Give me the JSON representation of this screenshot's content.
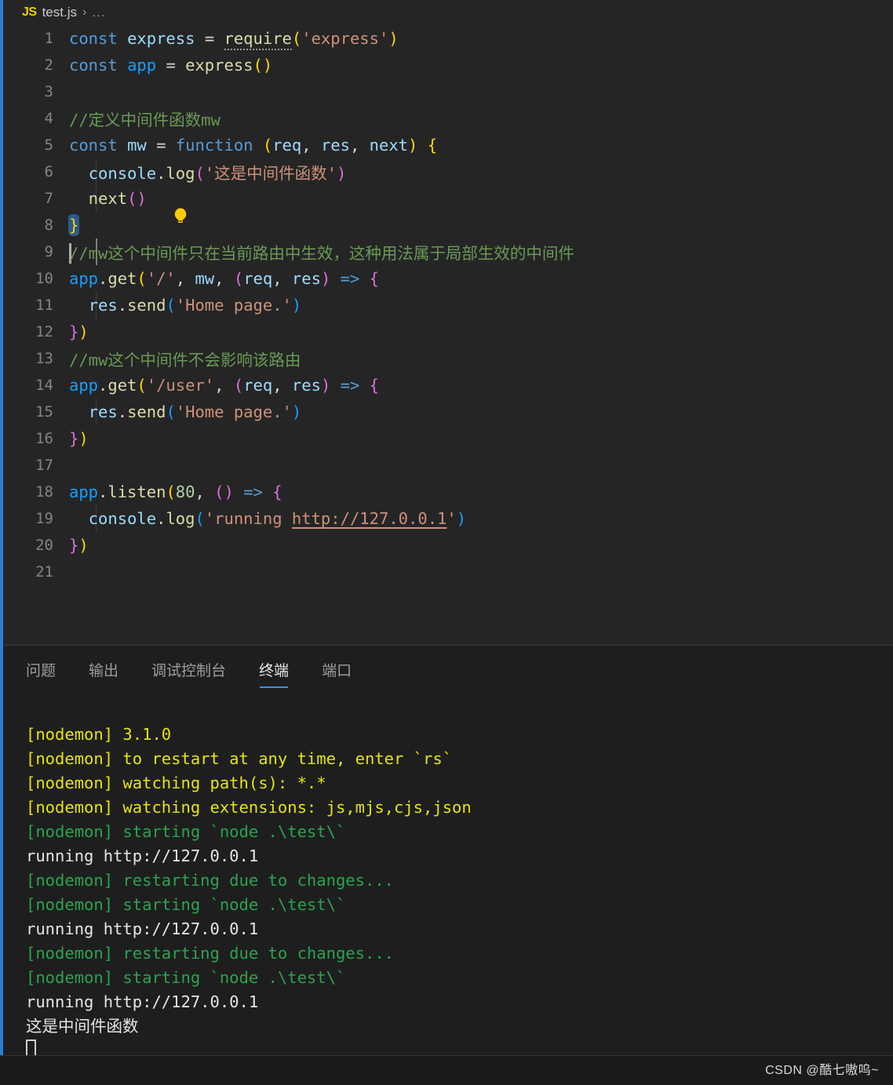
{
  "breadcrumb": {
    "lang_badge": "JS",
    "file": "test.js",
    "separator": "›",
    "ellipsis": "..."
  },
  "editor": {
    "lines": [
      {
        "no": "1",
        "text": "const express = require('express')"
      },
      {
        "no": "2",
        "text": "const app = express()"
      },
      {
        "no": "3",
        "text": ""
      },
      {
        "no": "4",
        "text": "//定义中间件函数mw"
      },
      {
        "no": "5",
        "text": "const mw = function (req, res, next) {"
      },
      {
        "no": "6",
        "text": "  console.log('这是中间件函数')"
      },
      {
        "no": "7",
        "text": "  next()"
      },
      {
        "no": "8",
        "text": "}"
      },
      {
        "no": "9",
        "text": "//mw这个中间件只在当前路由中生效，这种用法属于局部生效的中间件"
      },
      {
        "no": "10",
        "text": "app.get('/', mw, (req, res) => {"
      },
      {
        "no": "11",
        "text": "  res.send('Home page.')"
      },
      {
        "no": "12",
        "text": "})"
      },
      {
        "no": "13",
        "text": "//mw这个中间件不会影响该路由"
      },
      {
        "no": "14",
        "text": "app.get('/user', (req, res) => {"
      },
      {
        "no": "15",
        "text": "  res.send('Home page.')"
      },
      {
        "no": "16",
        "text": "})"
      },
      {
        "no": "17",
        "text": ""
      },
      {
        "no": "18",
        "text": "app.listen(80, () => {"
      },
      {
        "no": "19",
        "text": "  console.log('running http://127.0.0.1')"
      },
      {
        "no": "20",
        "text": "})"
      },
      {
        "no": "21",
        "text": ""
      }
    ],
    "tokens": {
      "kw_const": "const",
      "kw_function": "function",
      "id_express": "express",
      "id_app": "app",
      "id_mw": "mw",
      "fn_require": "require",
      "str_express": "'express'",
      "comment4": "//定义中间件函数mw",
      "comment9": "//mw这个中间件只在当前路由中生效，这种用法属于局部生效的中间件",
      "comment13": "//mw这个中间件不会影响该路由",
      "str_cn_middleware": "'这是中间件函数'",
      "str_home_page": "'Home page.'",
      "str_slash": "'/'",
      "str_user": "'/user'",
      "url": "http://127.0.0.1",
      "num_80": "80",
      "console": "console",
      "log": "log",
      "res": "res",
      "req": "req",
      "next": "next",
      "send": "send",
      "get": "get",
      "listen": "listen",
      "arrow": "=>"
    },
    "colors": {
      "keyword": "#569cd6",
      "variable": "#9cdcfe",
      "function": "#dcdcaa",
      "string": "#ce9178",
      "comment": "#6a9955",
      "number": "#b5cea8",
      "bracket1": "#ffd700",
      "bracket2": "#da70d6",
      "bracket3": "#179fff",
      "background": "#252526",
      "line_number": "#858585",
      "selection": "#2f5a8c"
    },
    "lightbulb": {
      "line": "7",
      "icon": "lightbulb-icon",
      "color": "#ffcc00"
    }
  },
  "panel": {
    "tabs": [
      {
        "label": "问题",
        "active": false
      },
      {
        "label": "输出",
        "active": false
      },
      {
        "label": "调试控制台",
        "active": false
      },
      {
        "label": "终端",
        "active": true
      },
      {
        "label": "端口",
        "active": false
      }
    ],
    "active_tab": "终端",
    "accent": "#3b92e0"
  },
  "terminal": {
    "lines": [
      {
        "text": "[nodemon] 3.1.0",
        "color": "yellow"
      },
      {
        "text": "[nodemon] to restart at any time, enter `rs`",
        "color": "yellow"
      },
      {
        "text": "[nodemon] watching path(s): *.*",
        "color": "yellow"
      },
      {
        "text": "[nodemon] watching extensions: js,mjs,cjs,json",
        "color": "yellow"
      },
      {
        "text": "[nodemon] starting `node .\\test\\`",
        "color": "green"
      },
      {
        "text": "running http://127.0.0.1",
        "color": "white"
      },
      {
        "text": "[nodemon] restarting due to changes...",
        "color": "green"
      },
      {
        "text": "[nodemon] starting `node .\\test\\`",
        "color": "green"
      },
      {
        "text": "running http://127.0.0.1",
        "color": "white"
      },
      {
        "text": "[nodemon] restarting due to changes...",
        "color": "green"
      },
      {
        "text": "[nodemon] starting `node .\\test\\`",
        "color": "green"
      },
      {
        "text": "running http://127.0.0.1",
        "color": "white"
      },
      {
        "text": "这是中间件函数",
        "color": "cn"
      }
    ],
    "colors": {
      "yellow": "#e5e510",
      "green": "#2aa44f",
      "white": "#e5e5e5"
    }
  },
  "watermark": "CSDN @酷七嗷呜~"
}
